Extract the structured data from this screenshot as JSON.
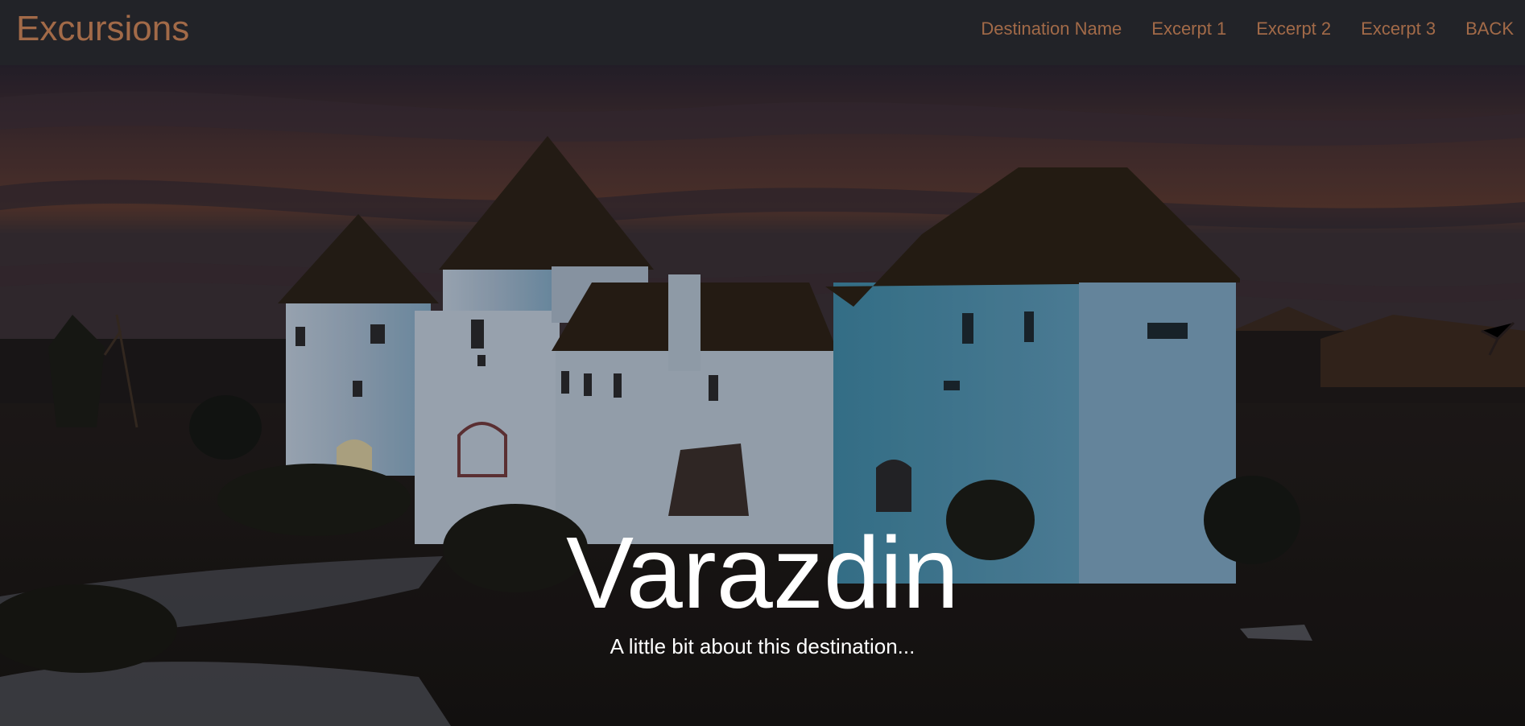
{
  "navbar": {
    "brand": "Excursions",
    "links": [
      "Destination Name",
      "Excerpt 1",
      "Excerpt 2",
      "Excerpt 3",
      "BACK"
    ]
  },
  "hero": {
    "title": "Varazdin",
    "subtitle": "A little bit about this destination...",
    "background_image": "castle-at-dusk-photo"
  },
  "colors": {
    "navbar_bg": "#222328",
    "accent": "#a26a48",
    "hero_text": "#ffffff"
  }
}
